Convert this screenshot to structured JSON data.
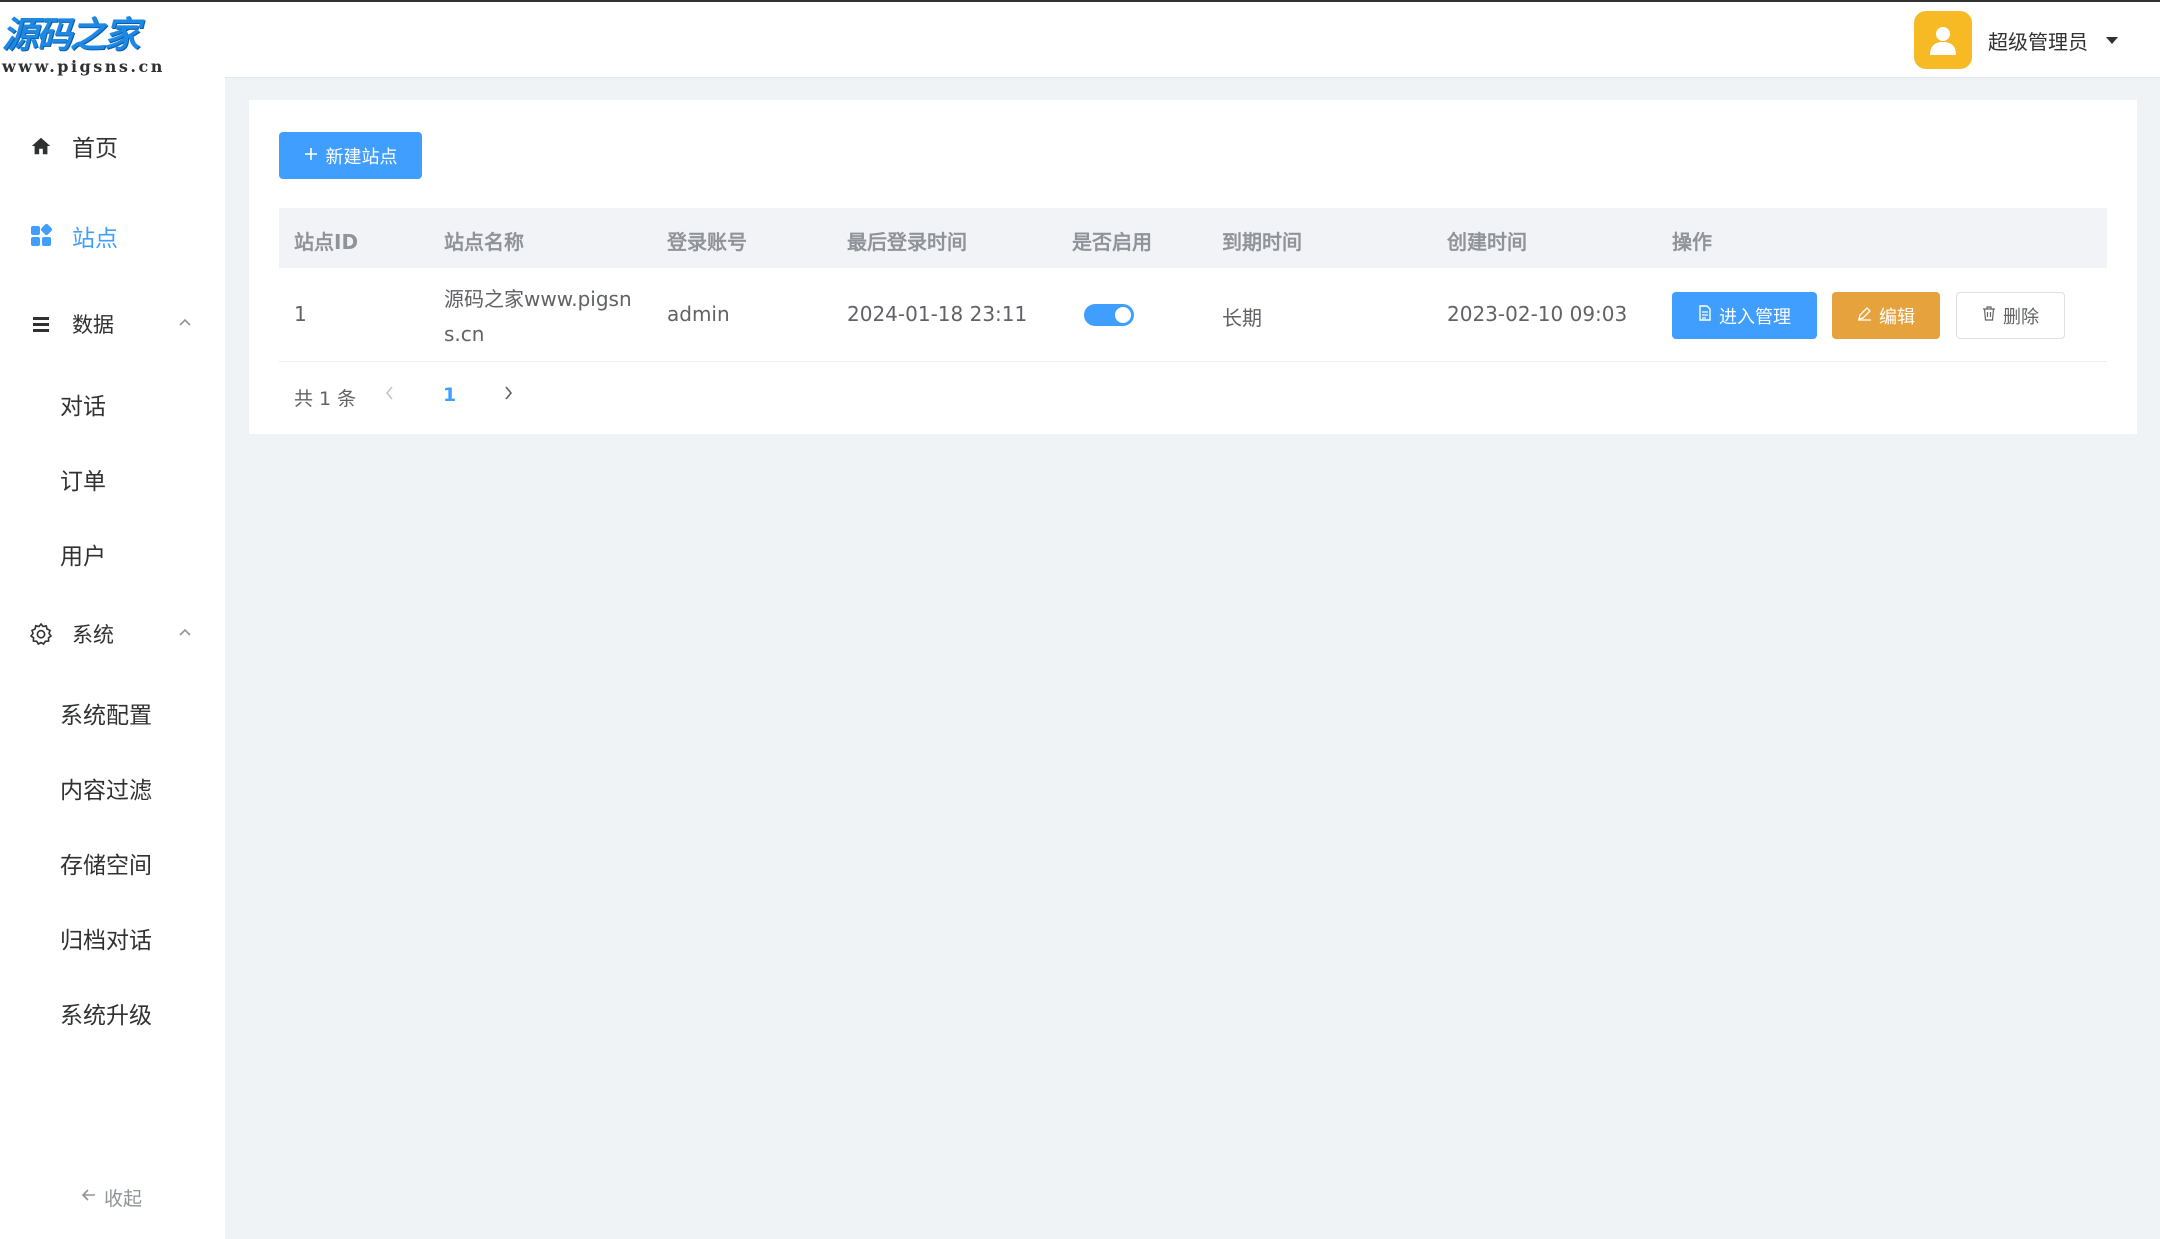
{
  "logo": {
    "main": "源码之家",
    "sub": "www.pigsns.cn"
  },
  "sidebar": {
    "home": "首页",
    "sites": "站点",
    "data": {
      "label": "数据",
      "items": [
        "对话",
        "订单",
        "用户"
      ]
    },
    "system": {
      "label": "系统",
      "items": [
        "系统配置",
        "内容过滤",
        "存储空间",
        "归档对话",
        "系统升级"
      ]
    },
    "collapse": "收起"
  },
  "header": {
    "user_name": "超级管理员"
  },
  "toolbar": {
    "new_site": "新建站点"
  },
  "table": {
    "columns": [
      "站点ID",
      "站点名称",
      "登录账号",
      "最后登录时间",
      "是否启用",
      "到期时间",
      "创建时间",
      "操作"
    ],
    "rows": [
      {
        "id": "1",
        "name": "源码之家www.pigsns.cn",
        "account": "admin",
        "last_login": "2024-01-18 23:11",
        "enabled": true,
        "expire": "长期",
        "created": "2023-02-10 09:03",
        "actions": {
          "manage": "进入管理",
          "edit": "编辑",
          "delete": "删除"
        }
      }
    ]
  },
  "pagination": {
    "total": "共 1 条",
    "current": "1"
  },
  "colors": {
    "primary": "#409eff",
    "warning": "#e6a23c",
    "avatar": "#f7b924"
  }
}
